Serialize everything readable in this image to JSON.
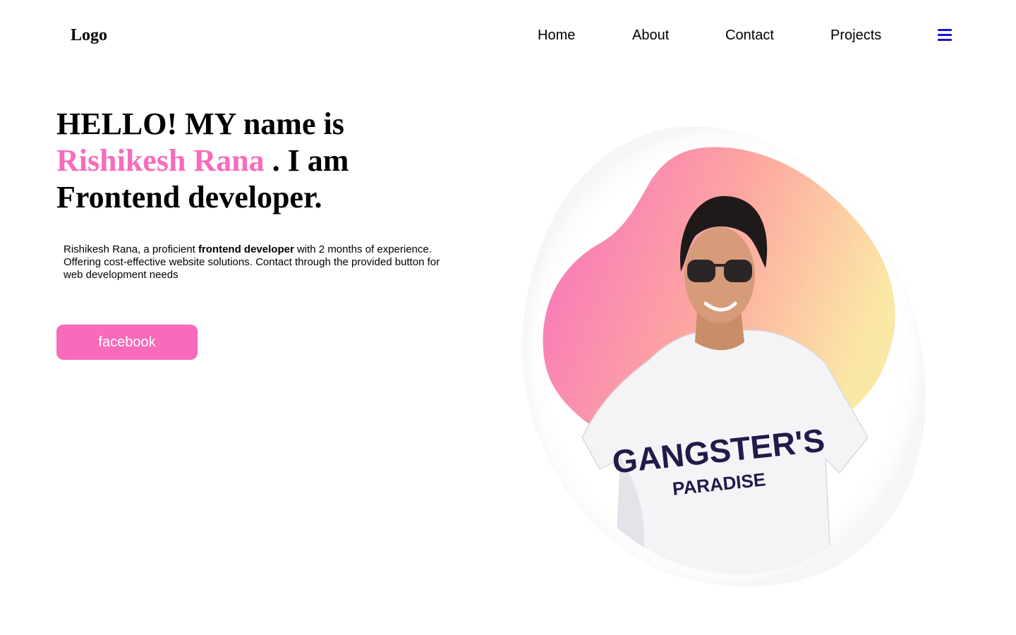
{
  "header": {
    "logo": "Logo",
    "nav": [
      {
        "label": "Home"
      },
      {
        "label": "About"
      },
      {
        "label": "Contact"
      },
      {
        "label": "Projects"
      }
    ],
    "menu_icon": "hamburger-menu-icon",
    "menu_icon_color": "#1a10d8"
  },
  "hero": {
    "heading_part1": "HELLO! MY name is ",
    "name": "Rishikesh Rana",
    "heading_part2": " . I am Frontend developer.",
    "bio_prefix": "Rishikesh Rana, a proficient ",
    "bio_bold": "frontend developer",
    "bio_suffix": " with 2 months of experience. Offering cost-effective website solutions. Contact through the provided button for web development needs",
    "button_label": "facebook",
    "shirt_text_line1": "GANGSTER'S",
    "shirt_text_line2": "PARADISE"
  },
  "colors": {
    "accent": "#f86bbb",
    "blob_gradient": [
      "#f76ec0",
      "#fda7a0",
      "#fbe7a6"
    ]
  }
}
